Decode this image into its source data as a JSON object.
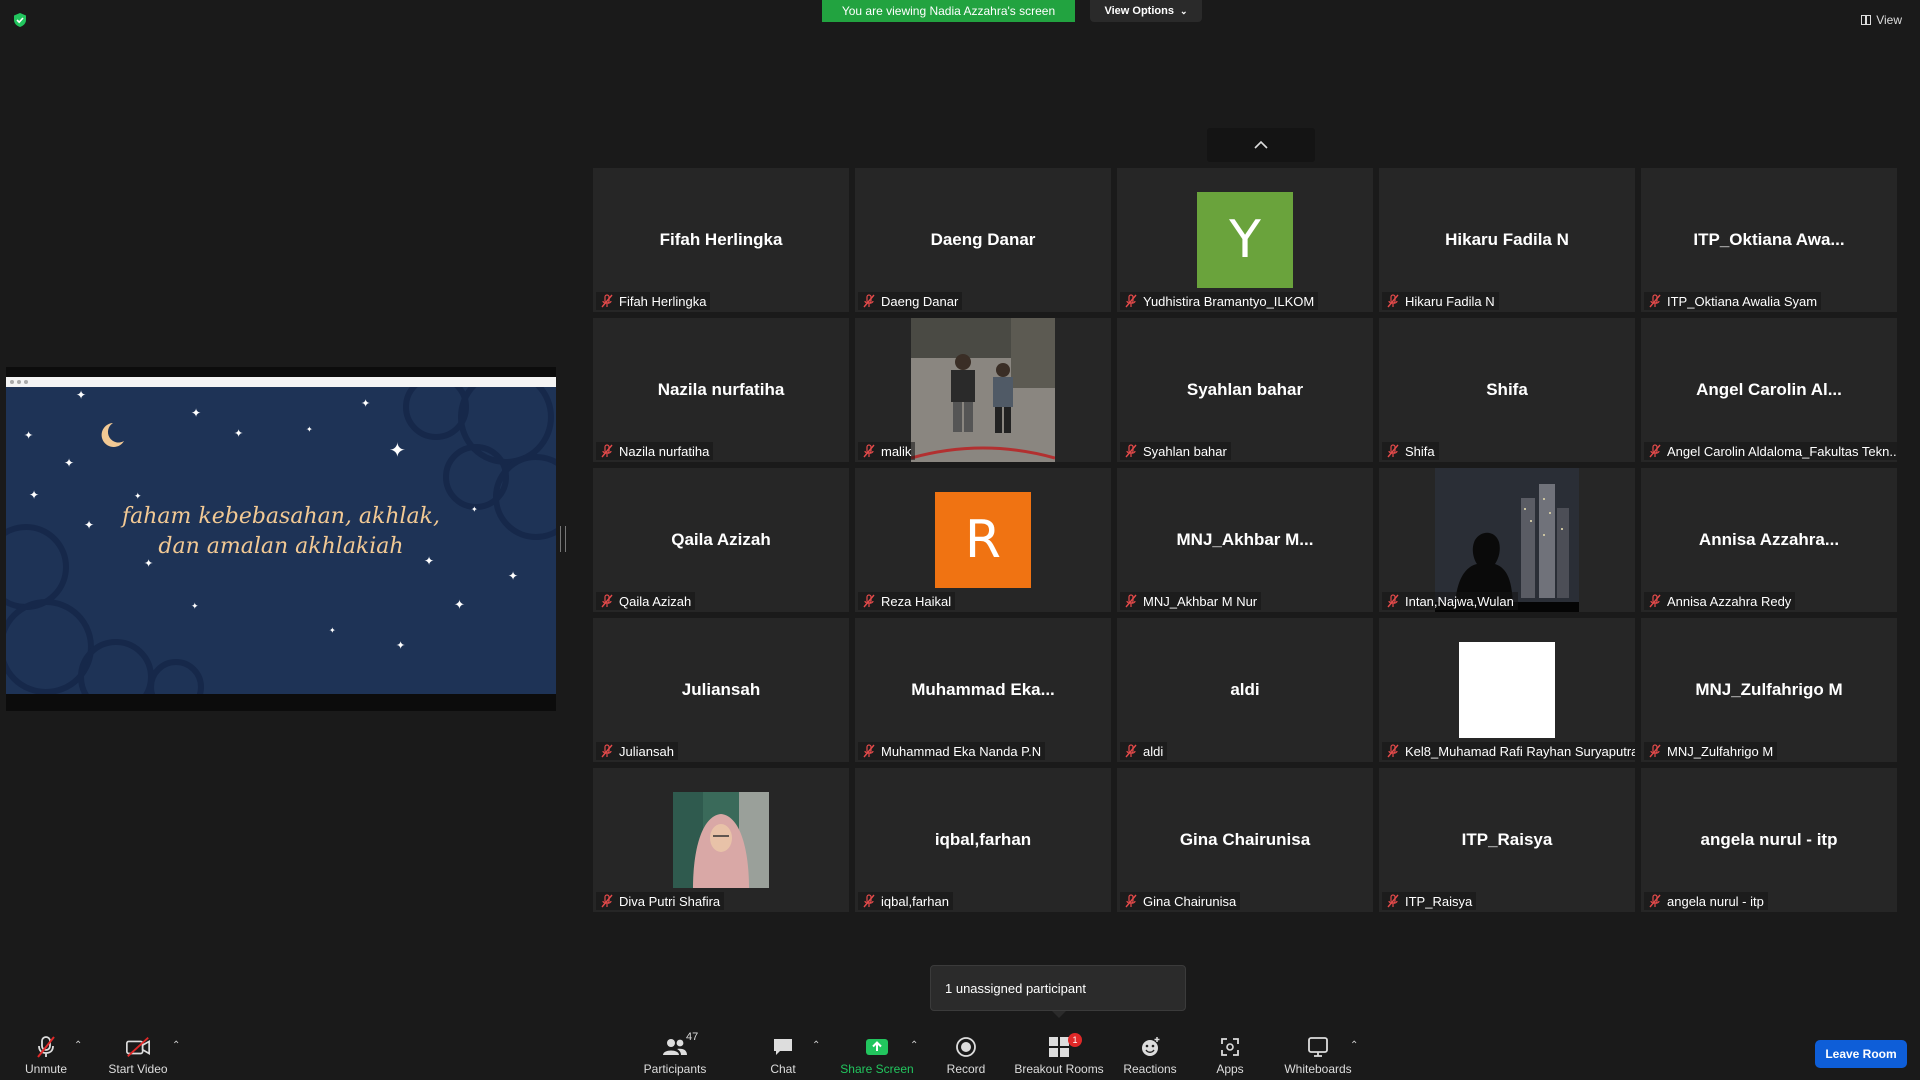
{
  "top": {
    "banner": "You are viewing Nadia Azzahra's screen",
    "view_options": "View Options",
    "view": "View"
  },
  "shared_slide": {
    "text_line1": "faham kebebasahan, akhlak,",
    "text_line2": "dan amalan akhlakiah"
  },
  "tiles": [
    {
      "name": "Fifah Herlingka",
      "label": "Fifah Herlingka"
    },
    {
      "name": "Daeng Danar",
      "label": "Daeng Danar"
    },
    {
      "avatar_letter": "Y",
      "avatar_color": "#6aa33c",
      "label": "Yudhistira Bramantyo_ILKOM"
    },
    {
      "name": "Hikaru Fadila N",
      "label": "Hikaru Fadila N"
    },
    {
      "name": "ITP_Oktiana  Awa...",
      "label": "ITP_Oktiana Awalia Syam"
    },
    {
      "name": "Nazila nurfatiha",
      "label": "Nazila nurfatiha"
    },
    {
      "video": "photo-two-people",
      "label": "malik"
    },
    {
      "name": "Syahlan bahar",
      "label": "Syahlan bahar"
    },
    {
      "name": "Shifa",
      "label": "Shifa"
    },
    {
      "name": "Angel  Carolin  Al...",
      "label": "Angel Carolin Aldaloma_Fakultas Tekn..."
    },
    {
      "name": "Qaila Azizah",
      "label": "Qaila Azizah"
    },
    {
      "avatar_letter": "R",
      "avatar_color": "#f07312",
      "label": "Reza Haikal"
    },
    {
      "name": "MNJ_Akhbar  M...",
      "label": "MNJ_Akhbar M Nur"
    },
    {
      "video": "night-city",
      "label": "Intan,Najwa,Wulan"
    },
    {
      "name": "Annisa  Azzahra...",
      "label": "Annisa Azzahra Redy"
    },
    {
      "name": "Juliansah",
      "label": "Juliansah"
    },
    {
      "name": "Muhammad  Eka...",
      "label": "Muhammad Eka Nanda P.N"
    },
    {
      "name": "aldi",
      "label": "aldi"
    },
    {
      "video": "white-square",
      "label": "Kel8_Muhamad Rafi Rayhan Suryaputra"
    },
    {
      "name": "MNJ_Zulfahrigo M",
      "label": "MNJ_Zulfahrigo M"
    },
    {
      "video": "woman-hijab",
      "label": "Diva Putri Shafira"
    },
    {
      "name": "iqbal,farhan",
      "label": "iqbal,farhan"
    },
    {
      "name": "Gina Chairunisa",
      "label": "Gina Chairunisa"
    },
    {
      "name": "ITP_Raisya",
      "label": "ITP_Raisya"
    },
    {
      "name": "angela nurul - itp",
      "label": "angela nurul - itp"
    }
  ],
  "tooltip": {
    "unassigned": "1 unassigned participant"
  },
  "toolbar": {
    "unmute": "Unmute",
    "start_video": "Start Video",
    "participants": "Participants",
    "participants_count": "47",
    "chat": "Chat",
    "share_screen": "Share Screen",
    "record": "Record",
    "breakout_rooms": "Breakout Rooms",
    "breakout_badge": "1",
    "reactions": "Reactions",
    "apps": "Apps",
    "whiteboards": "Whiteboards",
    "leave_room": "Leave Room"
  },
  "colors": {
    "banner_green": "#22a340",
    "leave_blue": "#0e5ed8",
    "tile_bg": "#262626"
  }
}
